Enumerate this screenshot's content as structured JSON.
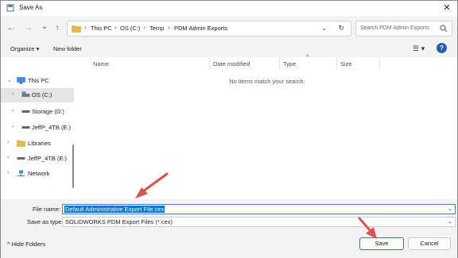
{
  "window": {
    "title": "Save As",
    "close_glyph": "✕"
  },
  "nav": {
    "back_glyph": "←",
    "forward_glyph": "→",
    "recent_glyph": "⌄",
    "up_glyph": "↑",
    "breadcrumbs": [
      "This PC",
      "OS (C:)",
      "Temp",
      "PDM Admin Exports"
    ],
    "separator": "›",
    "dropdown_glyph": "⌄",
    "refresh_glyph": "↻",
    "search_placeholder": "Search PDM Admin Exports"
  },
  "toolbar": {
    "organize_label": "Organize ▾",
    "new_folder_label": "New folder",
    "view_glyph": "☰ ▾",
    "help_glyph": "?"
  },
  "sidebar": {
    "items": [
      {
        "label": "This PC",
        "icon": "computer-icon",
        "chevron": "⌄"
      },
      {
        "label": "OS (C:)",
        "icon": "drive-icon",
        "chevron": "›"
      },
      {
        "label": "Storage (D:)",
        "icon": "drive-icon",
        "chevron": "›"
      },
      {
        "label": "JeffP_4TB (E:)",
        "icon": "drive-icon",
        "chevron": "›"
      },
      {
        "label": "Libraries",
        "icon": "folder-icon",
        "chevron": "›"
      },
      {
        "label": "JeffP_4TB (E:)",
        "icon": "drive-icon",
        "chevron": "›"
      },
      {
        "label": "Network",
        "icon": "network-icon",
        "chevron": "›"
      }
    ]
  },
  "files": {
    "columns": [
      "Name",
      "Date modified",
      "Type",
      "Size"
    ],
    "sort_glyph": "^",
    "empty_message": "No items match your search."
  },
  "form": {
    "file_name_label": "File name:",
    "file_name_value": "Default Administrative Export File.cex",
    "save_as_type_label": "Save as type:",
    "save_as_type_value": "SOLIDWORKS PDM Export Files (*.cex)",
    "dropdown_glyph": "⌄"
  },
  "footer": {
    "hide_folders_label": "^  Hide Folders",
    "save_label": "Save",
    "cancel_label": "Cancel"
  },
  "colors": {
    "accent": "#0078d4",
    "annotation_arrow": "#d9534f",
    "folder": "#e8b84a"
  }
}
